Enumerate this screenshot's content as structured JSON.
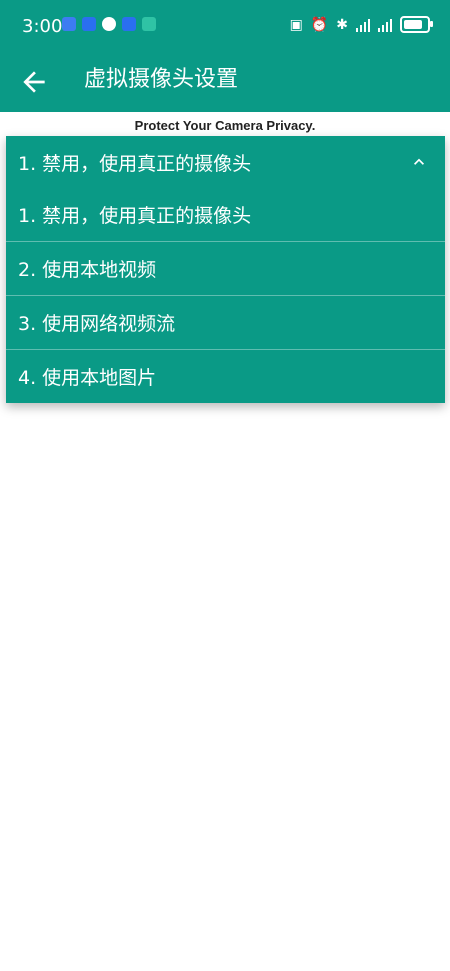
{
  "status_bar": {
    "time": "3:00",
    "notification_icons": [
      {
        "name": "upload-app-icon",
        "color": "#3d7cf2"
      },
      {
        "name": "message-app-icon",
        "color": "#2a6ff0"
      },
      {
        "name": "qq-penguin-icon",
        "color": "#111111"
      },
      {
        "name": "mail-app-icon",
        "color": "#2a6ff0"
      },
      {
        "name": "download-app-icon",
        "color": "#2fc3a5"
      }
    ]
  },
  "app_bar": {
    "title": "虚拟摄像头设置"
  },
  "subtitle": "Protect Your Camera Privacy.",
  "dropdown": {
    "selected": "1. 禁用，使用真正的摄像头",
    "options": [
      "1. 禁用，使用真正的摄像头",
      "2. 使用本地视频",
      "3. 使用网络视频流",
      "4. 使用本地图片"
    ]
  },
  "colors": {
    "primary": "#0a9a86",
    "text_on_primary": "#ffffff"
  }
}
